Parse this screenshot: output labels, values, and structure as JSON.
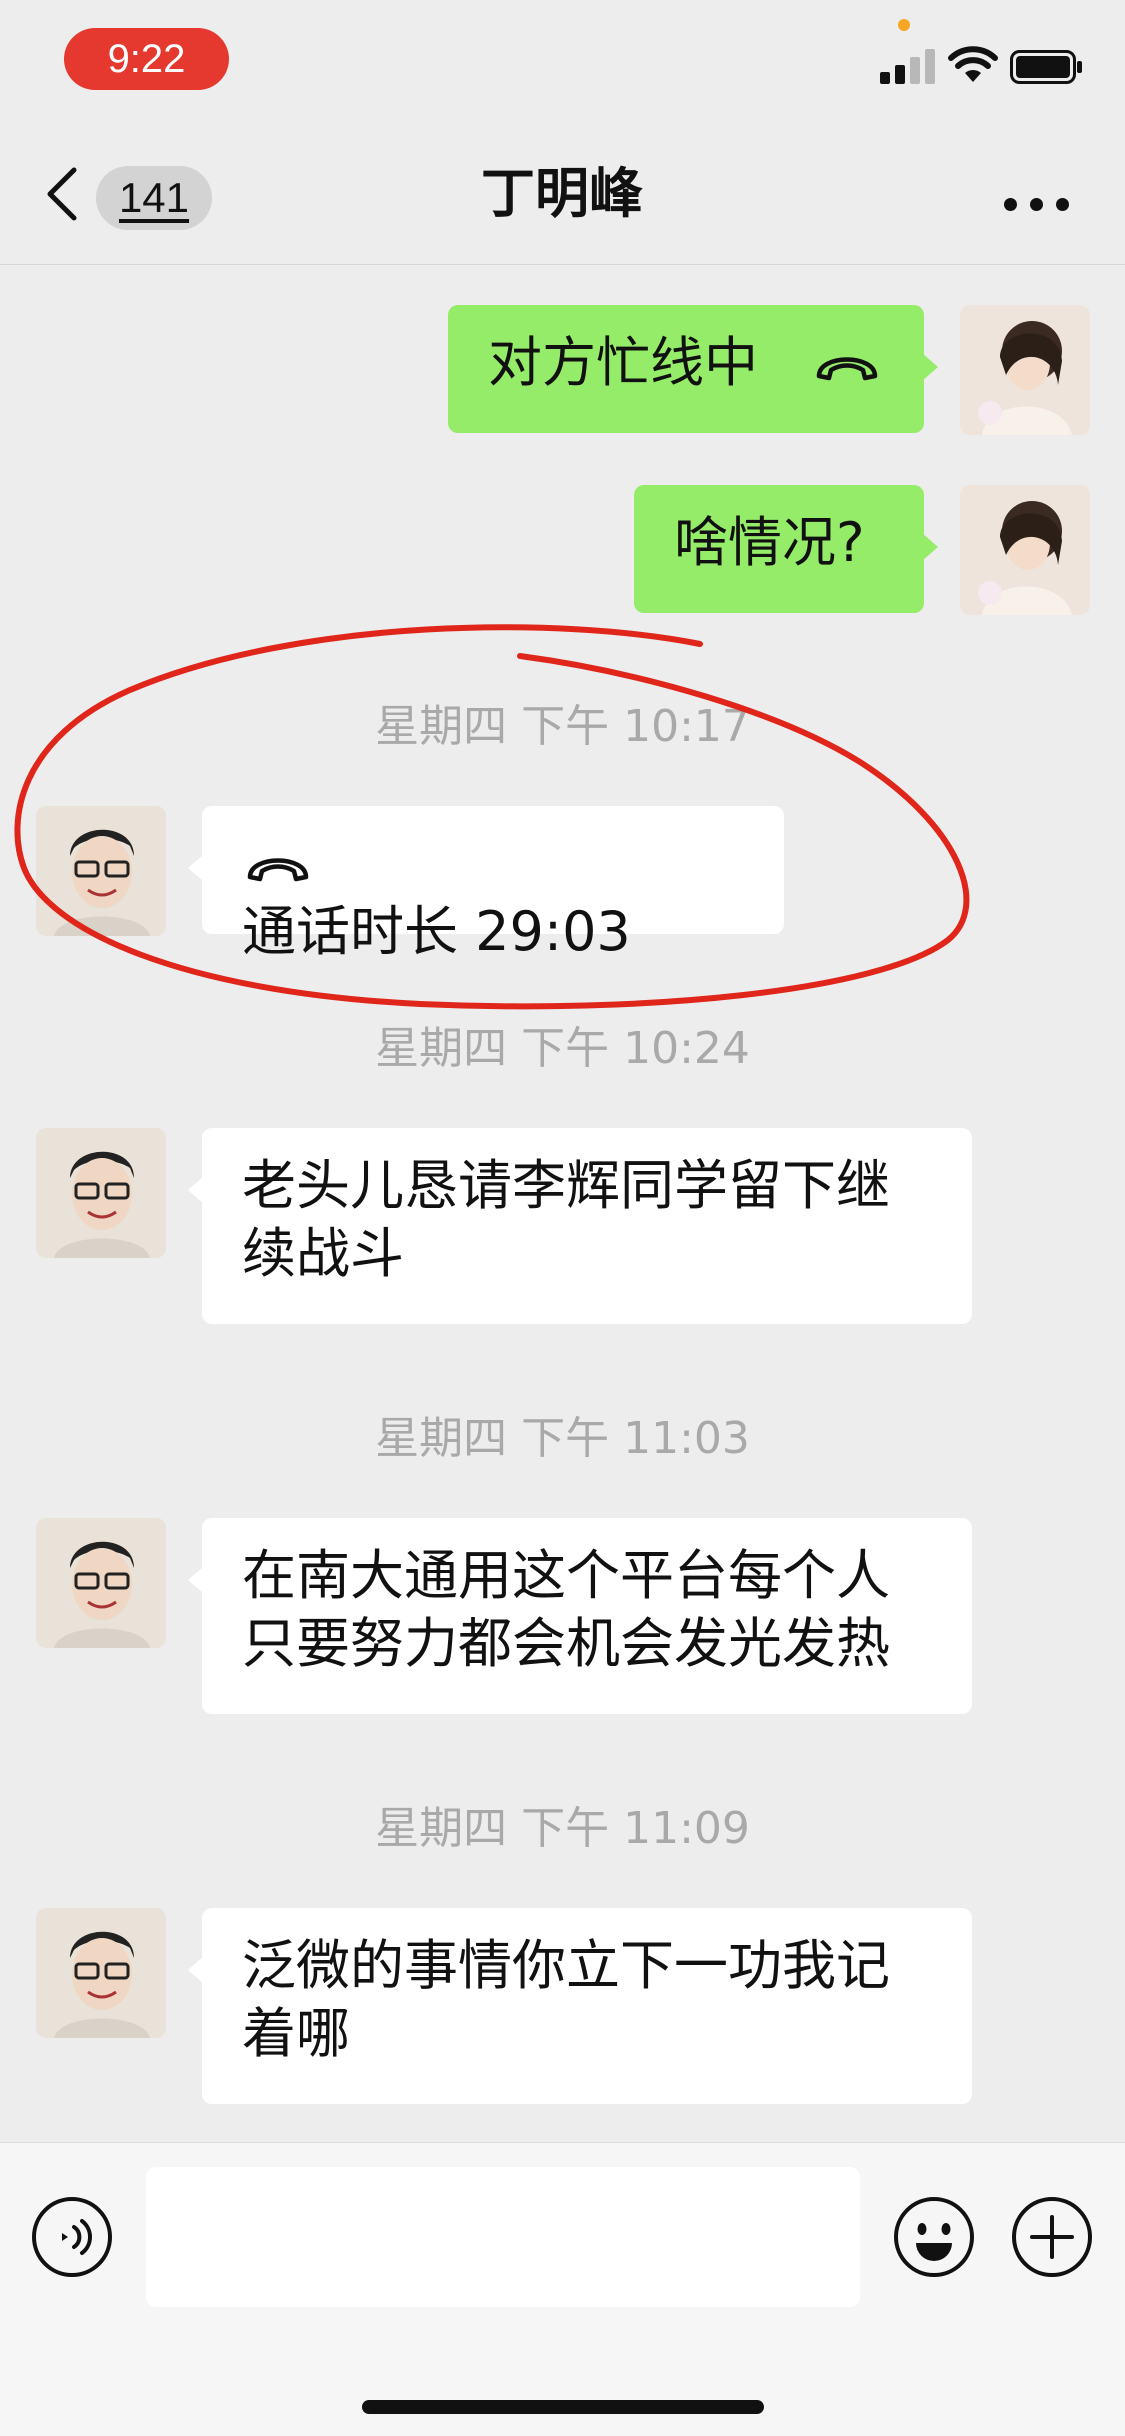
{
  "status_bar": {
    "time": "9:22",
    "icons": [
      "signal-icon",
      "wifi-icon",
      "battery-icon"
    ]
  },
  "nav": {
    "back_icon": "chevron-left-icon",
    "unread_count": "141",
    "title": "丁明峰",
    "more_icon": "more-dots-icon"
  },
  "messages": [
    {
      "side": "right",
      "type": "call",
      "text": "对方忙线中",
      "icon": "phone-hangup-icon"
    },
    {
      "side": "right",
      "type": "text",
      "text": "啥情况?"
    },
    {
      "type": "timestamp",
      "text": "星期四 下午 10:17"
    },
    {
      "side": "left",
      "type": "call",
      "text": "通话时长 29:03",
      "icon": "phone-hangup-icon"
    },
    {
      "type": "timestamp",
      "text": "星期四 下午 10:24"
    },
    {
      "side": "left",
      "type": "text",
      "text": "老头儿恳请李辉同学留下继续战斗"
    },
    {
      "type": "timestamp",
      "text": "星期四 下午 11:03"
    },
    {
      "side": "left",
      "type": "text",
      "text": "在南大通用这个平台每个人只要努力都会机会发光发热"
    },
    {
      "type": "timestamp",
      "text": "星期四 下午 11:09"
    },
    {
      "side": "left",
      "type": "text",
      "text": "泛微的事情你立下一功我记着哪"
    }
  ],
  "input_bar": {
    "voice_icon": "voice-icon",
    "input_value": "",
    "emoji_icon": "emoji-icon",
    "plus_icon": "plus-icon"
  },
  "colors": {
    "background": "#ededed",
    "outgoing_bubble": "#95ec69",
    "incoming_bubble": "#ffffff",
    "timestamp_text": "#a9a9a9",
    "annotation_ring": "#e0261b",
    "time_pill": "#e5392f"
  }
}
